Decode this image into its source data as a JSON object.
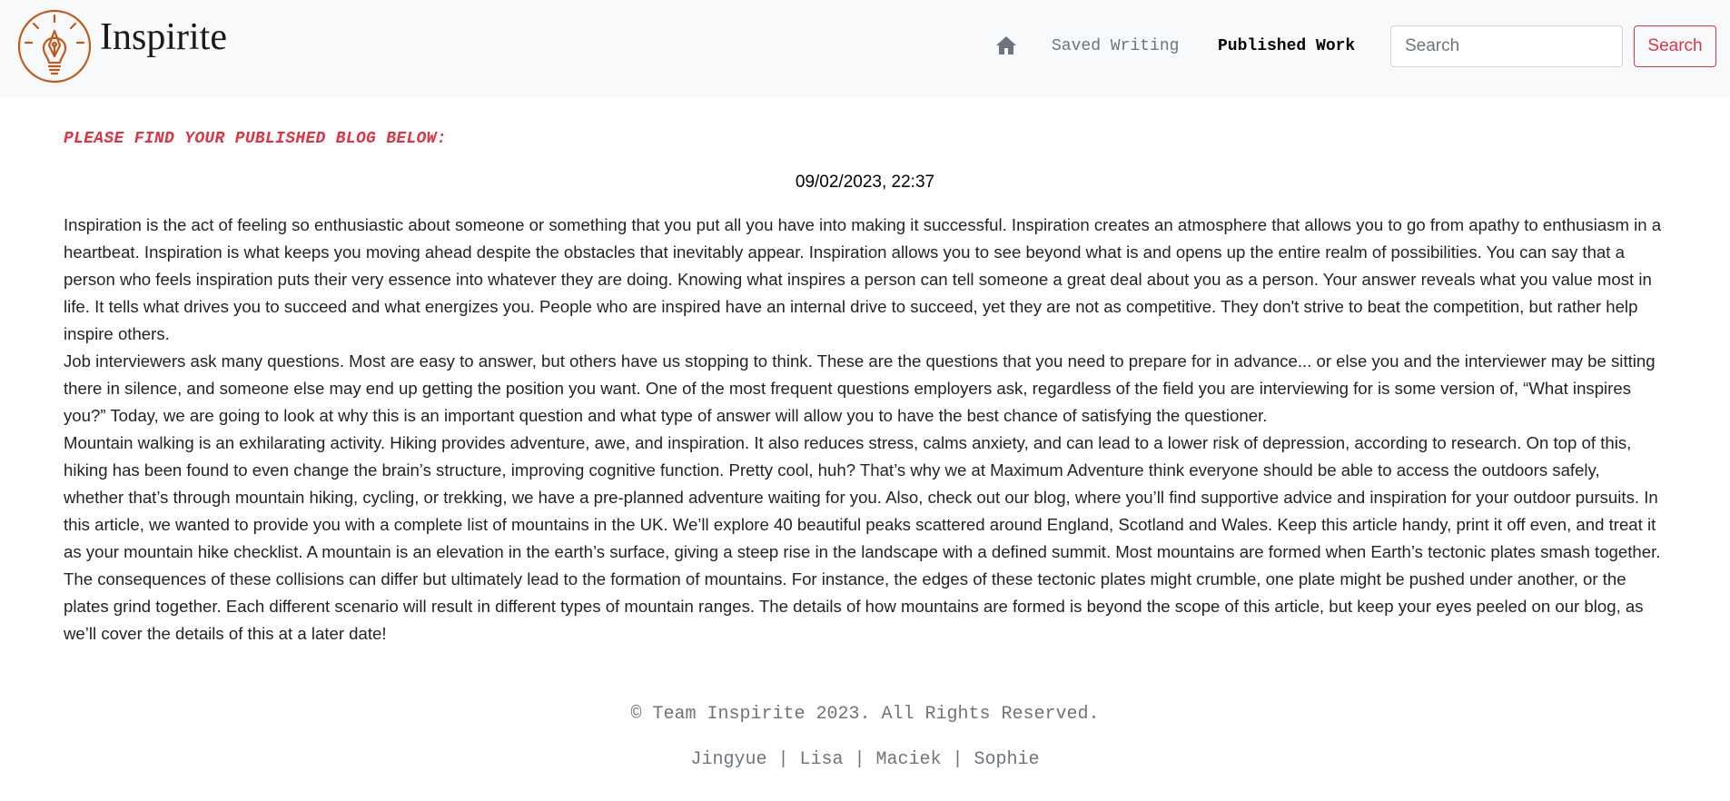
{
  "header": {
    "brand": "Inspirite",
    "logo_icon": "pen-nib-lightbulb-icon",
    "home_icon": "home-icon",
    "nav": {
      "saved_writing": "Saved Writing",
      "published_work": "Published Work"
    },
    "search": {
      "placeholder": "Search",
      "button_label": "Search"
    }
  },
  "main": {
    "notice": "PLEASE FIND YOUR PUBLISHED BLOG BELOW:",
    "date": "09/02/2023, 22:37",
    "paragraphs": [
      "Inspiration is the act of feeling so enthusiastic about someone or something that you put all you have into making it successful. Inspiration creates an atmosphere that allows you to go from apathy to enthusiasm in a heartbeat. Inspiration is what keeps you moving ahead despite the obstacles that inevitably appear. Inspiration allows you to see beyond what is and opens up the entire realm of possibilities. You can say that a person who feels inspiration puts their very essence into whatever they are doing. Knowing what inspires a person can tell someone a great deal about you as a person. Your answer reveals what you value most in life. It tells what drives you to succeed and what energizes you. People who are inspired have an internal drive to succeed, yet they are not as competitive. They don't strive to beat the competition, but rather help inspire others.",
      "Job interviewers ask many questions. Most are easy to answer, but others have us stopping to think. These are the questions that you need to prepare for in advance... or else you and the interviewer may be sitting there in silence, and someone else may end up getting the position you want. One of the most frequent questions employers ask, regardless of the field you are interviewing for is some version of, “What inspires you?” Today, we are going to look at why this is an important question and what type of answer will allow you to have the best chance of satisfying the questioner.",
      "Mountain walking is an exhilarating activity. Hiking provides adventure, awe, and inspiration. It also reduces stress, calms anxiety, and can lead to a lower risk of depression, according to research. On top of this, hiking has been found to even change the brain’s structure, improving cognitive function. Pretty cool, huh? That’s why we at Maximum Adventure think everyone should be able to access the outdoors safely, whether that’s through mountain hiking, cycling, or trekking, we have a pre-planned adventure waiting for you. Also, check out our blog, where you’ll find supportive advice and inspiration for your outdoor pursuits. In this article, we wanted to provide you with a complete list of mountains in the UK. We’ll explore 40 beautiful peaks scattered around England, Scotland and Wales. Keep this article handy, print it off even, and treat it as your mountain hike checklist. A mountain is an elevation in the earth’s surface, giving a steep rise in the landscape with a defined summit. Most mountains are formed when Earth’s tectonic plates smash together. The consequences of these collisions can differ but ultimately lead to the formation of mountains. For instance, the edges of these tectonic plates might crumble, one plate might be pushed under another, or the plates grind together. Each different scenario will result in different types of mountain ranges. The details of how mountains are formed is beyond the scope of this article, but keep your eyes peeled on our blog, as we’ll cover the details of this at a later date!"
    ]
  },
  "footer": {
    "copyright": "© Team Inspirite 2023. All Rights Reserved.",
    "team": "Jingyue | Lisa | Maciek | Sophie"
  },
  "colors": {
    "accent": "#dc3545",
    "logo": "#c05a1a",
    "navbar_bg": "#f8f9fa",
    "muted": "#6c757d"
  }
}
